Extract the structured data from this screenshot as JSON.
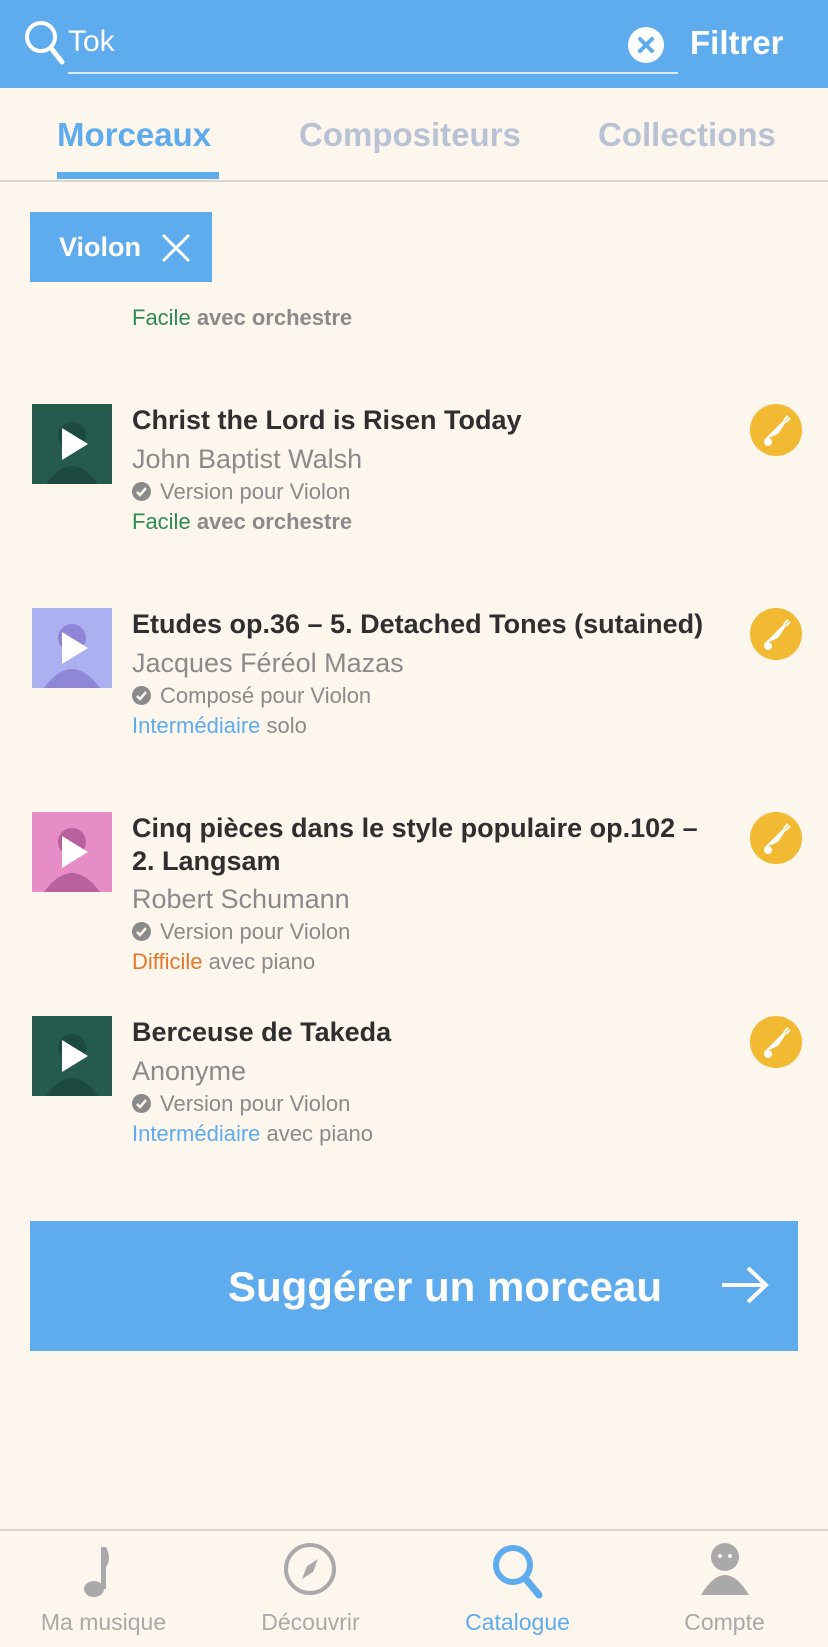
{
  "search": {
    "value": "Tok",
    "filter_label": "Filtrer"
  },
  "tabs": [
    {
      "label": "Morceaux",
      "active": true
    },
    {
      "label": "Compositeurs",
      "active": false
    },
    {
      "label": "Collections",
      "active": false
    }
  ],
  "chip": {
    "label": "Violon"
  },
  "partial_item": {
    "level": "Facile",
    "accompaniment": "avec orchestre"
  },
  "items": [
    {
      "title": "Christ the Lord is Risen Today",
      "composer": "John Baptist Walsh",
      "version": "Version pour Violon",
      "level": "Facile",
      "accompaniment": "avec orchestre",
      "thumb_color": "#255a4e"
    },
    {
      "title": "Etudes op.36 – 5. Detached Tones (sutained)",
      "composer": "Jacques Féréol Mazas",
      "version": "Composé pour Violon",
      "level": "Intermédiaire",
      "accompaniment": "solo",
      "thumb_color": "#aab0f0"
    },
    {
      "title": "Cinq pièces dans le style populaire op.102 – 2. Langsam",
      "composer": "Robert Schumann",
      "version": "Version pour Violon",
      "level": "Difficile",
      "accompaniment": "avec piano",
      "thumb_color": "#e68cc6"
    },
    {
      "title": "Berceuse de Takeda",
      "composer": "Anonyme",
      "version": "Version pour Violon",
      "level": "Intermédiaire",
      "accompaniment": "avec piano",
      "thumb_color": "#255a4e"
    }
  ],
  "suggest": {
    "label": "Suggérer un morceau"
  },
  "nav": [
    {
      "label": "Ma musique",
      "icon": "music-note-icon",
      "active": false
    },
    {
      "label": "Découvrir",
      "icon": "compass-icon",
      "active": false
    },
    {
      "label": "Catalogue",
      "icon": "search-icon",
      "active": true
    },
    {
      "label": "Compte",
      "icon": "user-icon",
      "active": false
    }
  ],
  "colors": {
    "accent": "#5eabee",
    "background": "#fdf6ec",
    "favorite": "#f2b933",
    "easy": "#2e8b57",
    "intermediate": "#5eabee",
    "hard": "#e8772e"
  }
}
